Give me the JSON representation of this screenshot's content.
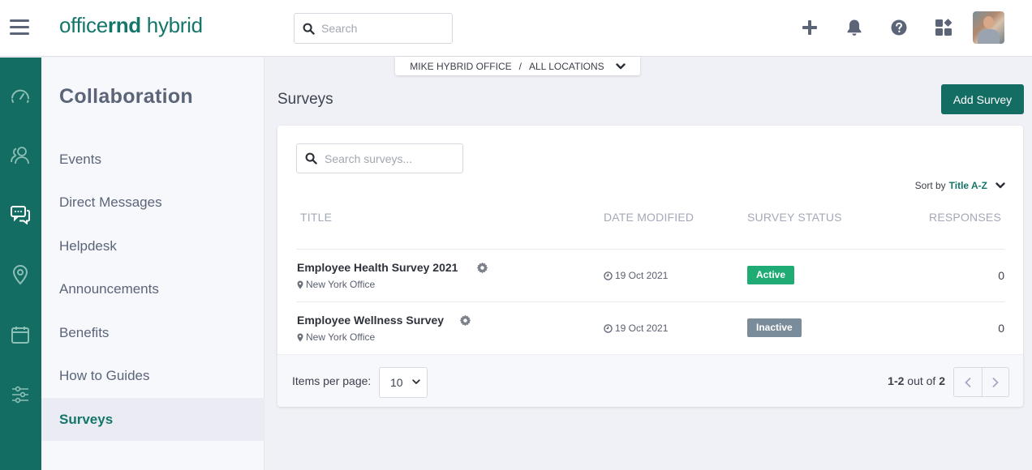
{
  "app": {
    "logo_light_1": "office",
    "logo_bold": "rnd",
    "logo_light_2": " hybrid"
  },
  "topbar": {
    "search_placeholder": "Search",
    "icons": [
      "plus-icon",
      "bell-icon",
      "help-icon",
      "apps-icon"
    ],
    "avatar_alt": "User avatar"
  },
  "rail": {
    "items": [
      {
        "icon": "dashboard-icon",
        "active": false
      },
      {
        "icon": "people-icon",
        "active": false
      },
      {
        "icon": "chat-icon",
        "active": true
      },
      {
        "icon": "location-icon",
        "active": false
      },
      {
        "icon": "calendar-icon",
        "active": false
      },
      {
        "icon": "settings-sliders-icon",
        "active": false
      }
    ]
  },
  "sidenav": {
    "title": "Collaboration",
    "items": [
      {
        "label": "Events",
        "active": false
      },
      {
        "label": "Direct Messages",
        "active": false
      },
      {
        "label": "Helpdesk",
        "active": false
      },
      {
        "label": "Announcements",
        "active": false
      },
      {
        "label": "Benefits",
        "active": false
      },
      {
        "label": "How to Guides",
        "active": false
      },
      {
        "label": "Surveys",
        "active": true
      }
    ]
  },
  "location_switch": {
    "company": "MIKE HYBRID OFFICE",
    "separator": "/",
    "location": "ALL LOCATIONS"
  },
  "main": {
    "title": "Surveys",
    "add_button": "Add Survey",
    "search_placeholder": "Search surveys...",
    "sort": {
      "label": "Sort by",
      "value": "Title A-Z"
    },
    "columns": [
      "TITLE",
      "DATE MODIFIED",
      "SURVEY STATUS",
      "RESPONSES"
    ],
    "rows": [
      {
        "title": "Employee Health Survey 2021",
        "location": "New York Office",
        "date": "19 Oct 2021",
        "status": "Active",
        "status_color": "#1fab74",
        "responses": "0"
      },
      {
        "title": "Employee Wellness Survey",
        "location": "New York Office",
        "date": "19 Oct 2021",
        "status": "Inactive",
        "status_color": "#7a8c99",
        "responses": "0"
      }
    ],
    "footer": {
      "items_per_page_label": "Items per page:",
      "items_per_page_value": "10",
      "range": "1-2",
      "out_of_label": " out of ",
      "total": "2"
    }
  },
  "colors": {
    "brand": "#146d62",
    "active_badge": "#1fab74",
    "inactive_badge": "#7a8c99"
  }
}
